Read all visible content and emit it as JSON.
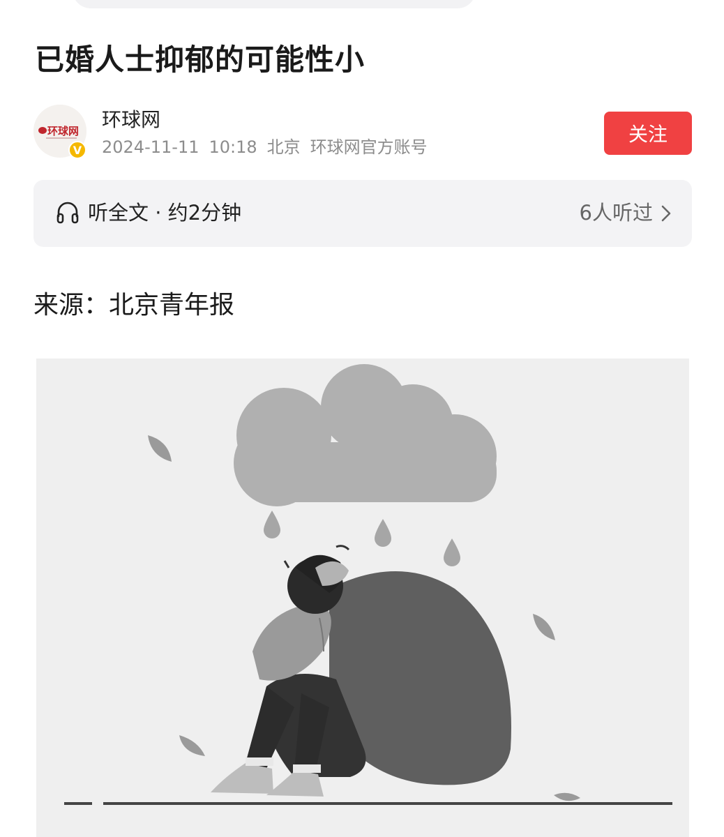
{
  "article": {
    "title": "已婚人士抑郁的可能性小",
    "source": "来源：北京青年报"
  },
  "author": {
    "name": "环球网",
    "avatar_logo_text": "环球网",
    "verified_badge": "V",
    "date": "2024-11-11",
    "time": "10:18",
    "location": "北京",
    "account_type": "环球网官方账号",
    "follow_label": "关注"
  },
  "listen": {
    "label": "听全文 · 约2分钟",
    "count": "6人听过",
    "icon": "headphone-icon"
  },
  "colors": {
    "follow_button": "#f04142",
    "listen_bar": "#f3f3f5",
    "meta_text": "#8c8c8c",
    "verified": "#f5b800"
  }
}
